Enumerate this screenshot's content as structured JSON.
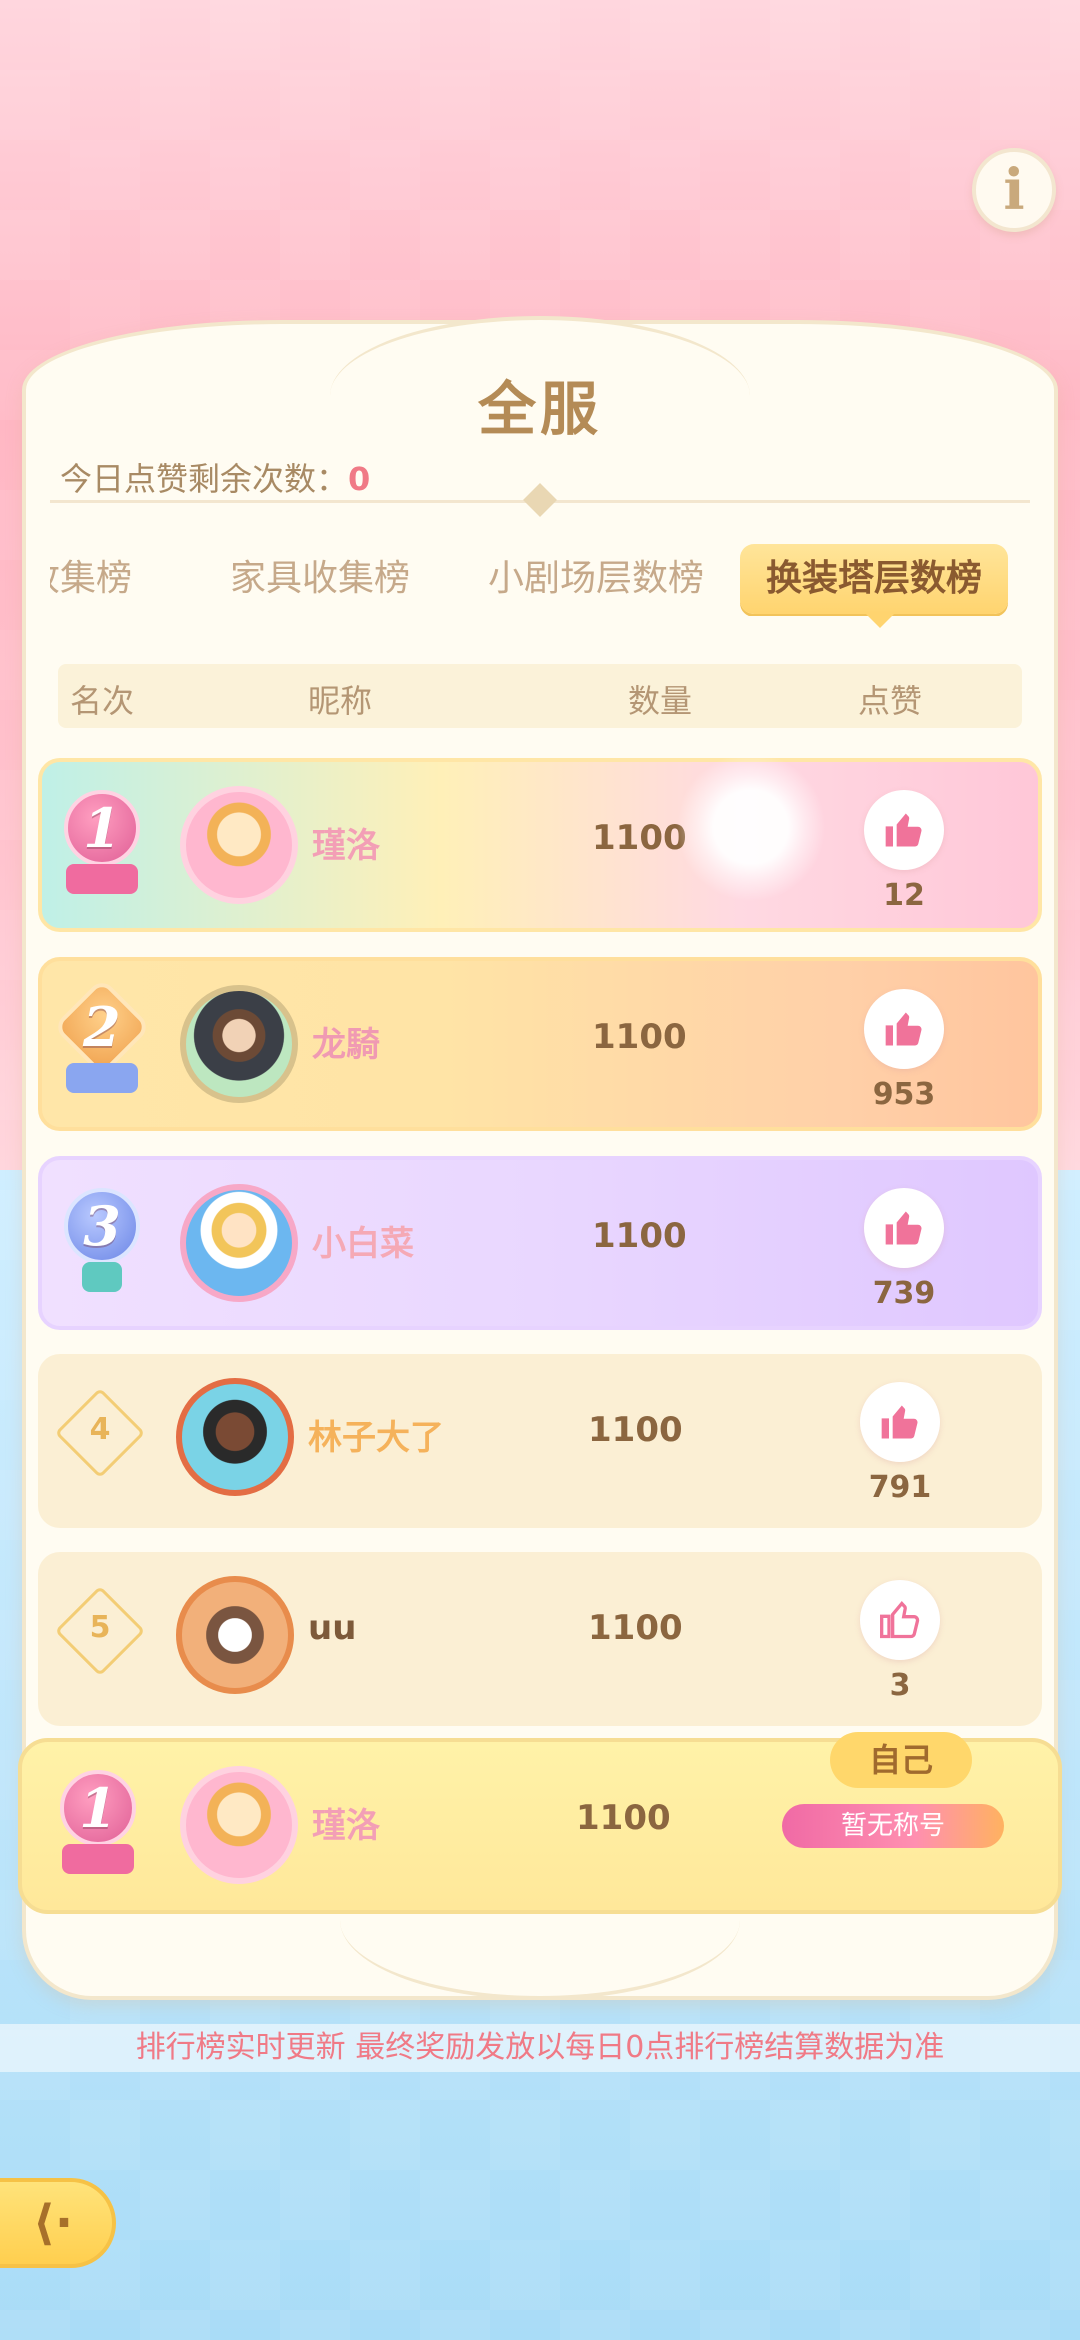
{
  "header": {
    "title": "全服",
    "likes_label": "今日点赞剩余次数：",
    "likes_remaining": "0"
  },
  "tabs": [
    {
      "label": "收集榜",
      "active": false
    },
    {
      "label": "家具收集榜",
      "active": false
    },
    {
      "label": "小剧场层数榜",
      "active": false
    },
    {
      "label": "换装塔层数榜",
      "active": true
    }
  ],
  "columns": {
    "rank": "名次",
    "nickname": "昵称",
    "quantity": "数量",
    "like": "点赞"
  },
  "rows": [
    {
      "rank": "1",
      "nickname": "瑾洛",
      "quantity": "1100",
      "likes": "12",
      "medal": "gold"
    },
    {
      "rank": "2",
      "nickname": "龙騎",
      "quantity": "1100",
      "likes": "953",
      "medal": "orange"
    },
    {
      "rank": "3",
      "nickname": "小白菜",
      "quantity": "1100",
      "likes": "739",
      "medal": "purple"
    },
    {
      "rank": "4",
      "nickname": "林子大了",
      "quantity": "1100",
      "likes": "791"
    },
    {
      "rank": "5",
      "nickname": "uu",
      "quantity": "1100",
      "likes": "3"
    }
  ],
  "self": {
    "rank": "1",
    "nickname": "瑾洛",
    "quantity": "1100",
    "tag": "自己",
    "title_badge": "暂无称号"
  },
  "footer": {
    "note": "排行榜实时更新 最终奖励发放以每日0点排行榜结算数据为准"
  },
  "icons": {
    "info": "i",
    "back": "⟨·"
  },
  "colors": {
    "accent": "#ffd46f",
    "like_icon": "#f0739a",
    "highlight_text": "#f07a86"
  }
}
